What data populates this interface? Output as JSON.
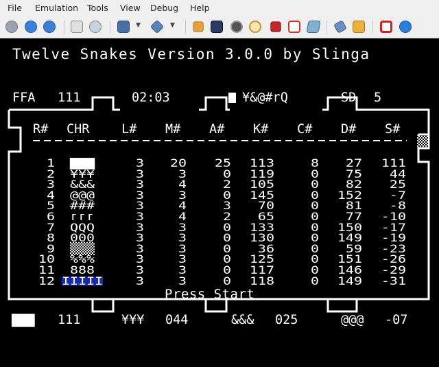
{
  "menu": [
    "File",
    "Emulation",
    "Tools",
    "View",
    "Debug",
    "Help"
  ],
  "toolbar_icons": [
    "back-icon",
    "pause-icon",
    "reset-icon",
    "load-snapshot-icon",
    "disk-icon",
    "save-icon",
    "tape-icon",
    "settings-icon",
    "monitor-icon",
    "eye-icon",
    "clock-icon",
    "chip-icon",
    "fullscreen-icon",
    "keyboard-icon",
    "joystick-icon",
    "folder-icon",
    "power-icon",
    "info-icon"
  ],
  "game": {
    "title": "Twelve Snakes Version 3.0.0 by Slinga",
    "status_top": {
      "mode": "FFA",
      "mode_value": "111",
      "time": "02:03",
      "player_tag": "¥&@#rQ",
      "speed_label": "SD",
      "speed_value": "5"
    },
    "table": {
      "headers": [
        "R#",
        "CHR",
        "L#",
        "M#",
        "A#",
        "K#",
        "C#",
        "D#",
        "S#"
      ],
      "rows": [
        [
          "1",
          "▇▇▇",
          "3",
          "20",
          "25",
          "113",
          "8",
          "27",
          "111"
        ],
        [
          "2",
          "¥¥¥",
          "3",
          "3",
          "0",
          "119",
          "0",
          "75",
          "44"
        ],
        [
          "3",
          "&&&",
          "3",
          "4",
          "2",
          "105",
          "0",
          "82",
          "25"
        ],
        [
          "4",
          "@@@",
          "3",
          "3",
          "0",
          "145",
          "0",
          "152",
          "-7"
        ],
        [
          "5",
          "###",
          "3",
          "4",
          "3",
          "70",
          "0",
          "81",
          "-8"
        ],
        [
          "6",
          "ᴦᴦᴦ",
          "3",
          "4",
          "2",
          "65",
          "0",
          "77",
          "-10"
        ],
        [
          "7",
          "QQQ",
          "3",
          "3",
          "0",
          "133",
          "0",
          "150",
          "-17"
        ],
        [
          "8",
          "000",
          "3",
          "3",
          "0",
          "130",
          "0",
          "149",
          "-19"
        ],
        [
          "9",
          "▒▒▒",
          "3",
          "3",
          "0",
          "36",
          "0",
          "59",
          "-23"
        ],
        [
          "10",
          "%%%",
          "3",
          "3",
          "0",
          "125",
          "0",
          "151",
          "-26"
        ],
        [
          "11",
          "888",
          "3",
          "3",
          "0",
          "117",
          "0",
          "146",
          "-29"
        ],
        [
          "12",
          "IIIII",
          "3",
          "3",
          "0",
          "118",
          "0",
          "149",
          "-31"
        ]
      ]
    },
    "prompt": "Press Start",
    "status_bottom": {
      "p1_char": "▇▇▇",
      "p1_score": "111",
      "p2_char": "¥¥¥",
      "p2_score": "044",
      "p3_char": "&&&",
      "p3_score": "025",
      "p4_char": "@@@",
      "p4_score": "-07"
    },
    "colors": {
      "bg": "#000000",
      "fg": "#ffffff",
      "highlight": "#1a2aa8"
    }
  }
}
